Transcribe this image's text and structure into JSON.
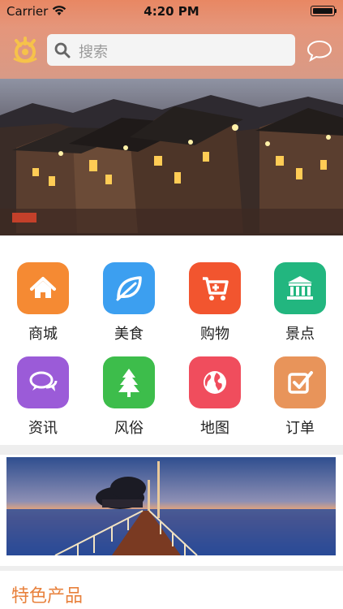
{
  "status_bar": {
    "carrier": "Carrier",
    "time": "4:20 PM"
  },
  "nav": {
    "search_placeholder": "搜索",
    "logo_icon": "app-logo-icon",
    "message_icon": "chat-bubble-icon"
  },
  "categories": [
    {
      "label": "商城",
      "icon": "home-icon",
      "color": "#f58a33"
    },
    {
      "label": "美食",
      "icon": "leaf-icon",
      "color": "#3c9ff0"
    },
    {
      "label": "购物",
      "icon": "cart-icon",
      "color": "#f2552f"
    },
    {
      "label": "景点",
      "icon": "museum-icon",
      "color": "#22b67f"
    },
    {
      "label": "资讯",
      "icon": "chat-icon",
      "color": "#9b5bd8"
    },
    {
      "label": "风俗",
      "icon": "tree-icon",
      "color": "#3dbd4b"
    },
    {
      "label": "地图",
      "icon": "globe-icon",
      "color": "#f04d5d"
    },
    {
      "label": "订单",
      "icon": "checkbox-icon",
      "color": "#e8945a"
    }
  ],
  "section": {
    "title": "特色产品"
  },
  "colors": {
    "accent": "#e8813c",
    "header": "#e58a6a"
  }
}
